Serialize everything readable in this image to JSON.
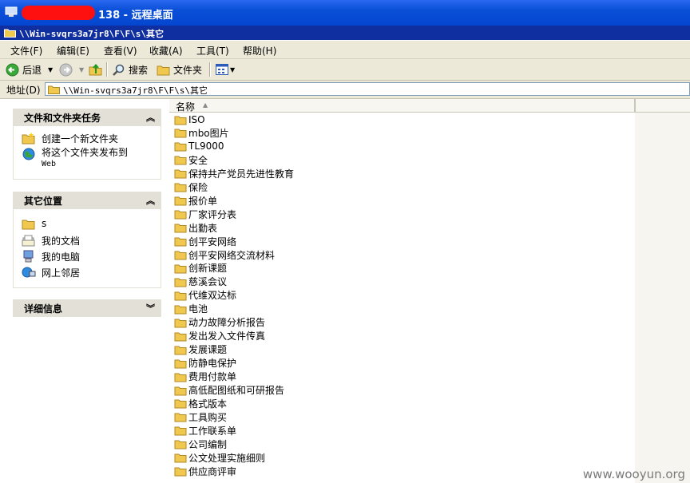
{
  "window": {
    "title": "138 - 远程桌面",
    "inner_title": "\\\\Win-svqrs3a7jr8\\F\\F\\s\\其它"
  },
  "menubar": {
    "items": [
      "文件(F)",
      "编辑(E)",
      "查看(V)",
      "收藏(A)",
      "工具(T)",
      "帮助(H)"
    ]
  },
  "toolbar": {
    "back_label": "后退",
    "search_label": "搜索",
    "folders_label": "文件夹"
  },
  "address": {
    "label": "地址(D)",
    "value": "\\\\Win-svqrs3a7jr8\\F\\F\\s\\其它"
  },
  "taskpane": {
    "file_tasks": {
      "title": "文件和文件夹任务",
      "items": [
        "创建一个新文件夹",
        "将这个文件夹发布到",
        "Web"
      ]
    },
    "other_places": {
      "title": "其它位置",
      "items": [
        "s",
        "我的文档",
        "我的电脑",
        "网上邻居"
      ]
    },
    "details": {
      "title": "详细信息"
    }
  },
  "list": {
    "column_name": "名称",
    "folders": [
      "ISO",
      "mbo图片",
      "TL9000",
      "安全",
      "保持共产党员先进性教育",
      "保险",
      "报价单",
      "厂家评分表",
      "出勤表",
      "创平安网络",
      "创平安网络交流材料",
      "创新课题",
      "慈溪会议",
      "代维双达标",
      "电池",
      "动力故障分析报告",
      "发出发入文件传真",
      "发展课题",
      "防静电保护",
      "费用付款单",
      "高低配图纸和可研报告",
      "格式版本",
      "工具购买",
      "工作联系单",
      "公司编制",
      "公文处理实施细则",
      "供应商评审"
    ]
  },
  "watermark": "www.wooyun.org",
  "colors": {
    "titlebar": "#0a4fd8",
    "redaction": "#ff1010",
    "chrome": "#ece9d8",
    "folder": "#f0c850"
  }
}
